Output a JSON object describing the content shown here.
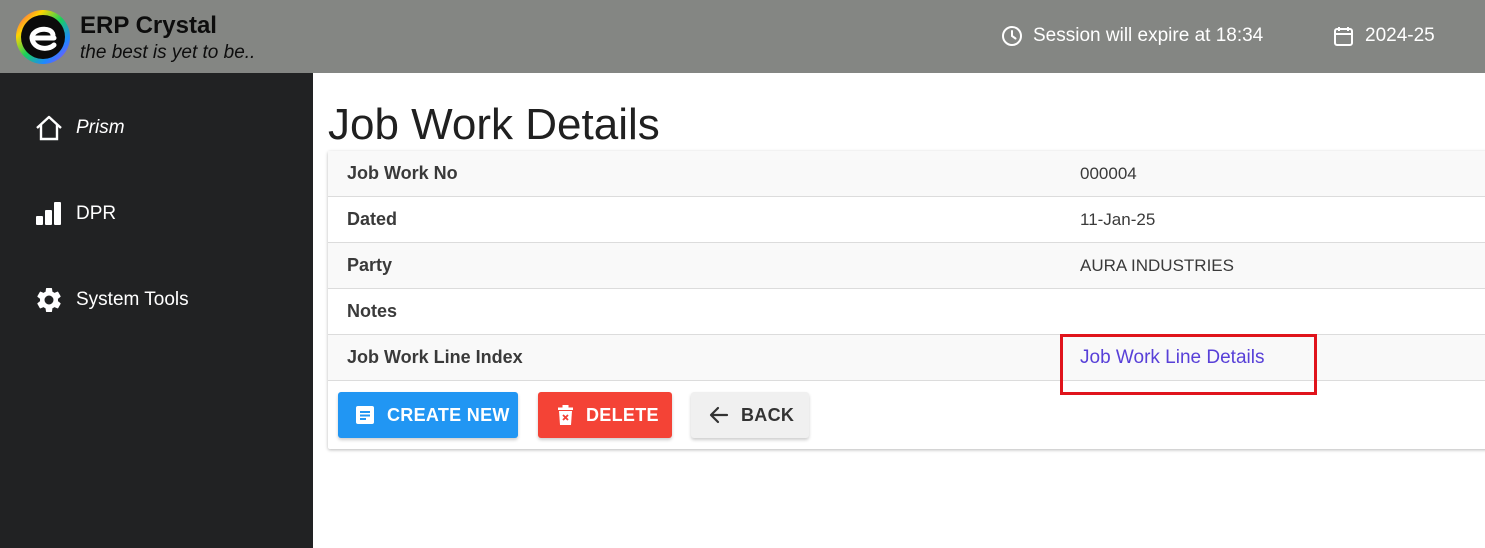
{
  "header": {
    "brand_title": "ERP Crystal",
    "brand_tagline": "the best is yet to be..",
    "session_text": "Session will expire at 18:34",
    "fiscal_year": "2024-25"
  },
  "sidebar": {
    "items": [
      {
        "label": "Prism",
        "icon": "home-icon"
      },
      {
        "label": "DPR",
        "icon": "bar-chart-icon"
      },
      {
        "label": "System Tools",
        "icon": "gear-icon"
      }
    ]
  },
  "main": {
    "title": "Job Work Details",
    "rows": [
      {
        "label": "Job Work No",
        "value": "000004"
      },
      {
        "label": "Dated",
        "value": "11-Jan-25"
      },
      {
        "label": "Party",
        "value": "AURA INDUSTRIES"
      },
      {
        "label": "Notes",
        "value": ""
      },
      {
        "label": "Job Work Line Index",
        "value": "Job Work Line Details"
      }
    ],
    "buttons": {
      "create": "CREATE NEW",
      "delete": "DELETE",
      "back": "BACK"
    }
  },
  "colors": {
    "topbar": "#848683",
    "sidebar": "#212223",
    "primary": "#2196f3",
    "danger": "#f44336",
    "link": "#5840d8",
    "highlight": "#e0141c"
  }
}
